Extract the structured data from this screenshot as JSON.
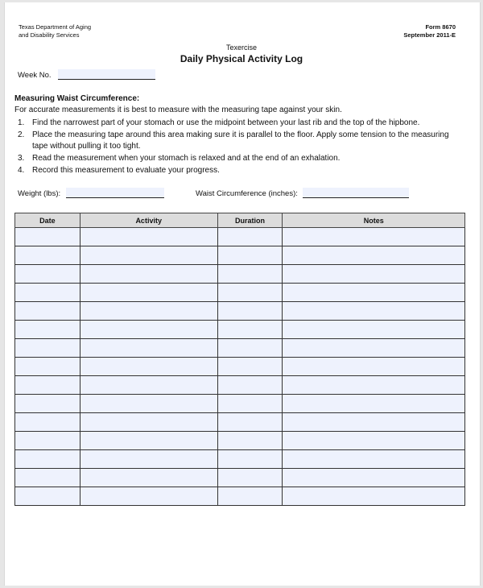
{
  "header": {
    "agency_line1": "Texas Department of Aging",
    "agency_line2": "and Disability Services",
    "form_number": "Form 8670",
    "form_date": "September 2011-E",
    "subtitle": "Texercise",
    "title": "Daily Physical Activity Log"
  },
  "week": {
    "label": "Week No.",
    "value": ""
  },
  "instructions": {
    "heading": "Measuring Waist Circumference:",
    "intro": "For accurate measurements it is best to measure with the measuring tape against your skin.",
    "steps": [
      {
        "num": "1.",
        "text": "Find the narrowest part of your stomach or use the midpoint between your last rib and the top of the hipbone."
      },
      {
        "num": "2.",
        "text": "Place the measuring tape around this area making sure it is parallel to the floor. Apply some tension to the measuring tape without pulling it too tight."
      },
      {
        "num": "3.",
        "text": "Read the measurement when your stomach is relaxed and at the end of an exhalation."
      },
      {
        "num": "4.",
        "text": "Record this measurement to evaluate your progress."
      }
    ]
  },
  "measurements": {
    "weight_label": "Weight (lbs):",
    "weight_value": "",
    "waist_label": "Waist Circumference (inches):",
    "waist_value": ""
  },
  "log_table": {
    "columns": [
      "Date",
      "Activity",
      "Duration",
      "Notes"
    ],
    "row_count": 15,
    "rows": []
  },
  "colors": {
    "field_fill": "#eef2fd",
    "header_fill": "#dcdcdc",
    "border": "#333333"
  }
}
